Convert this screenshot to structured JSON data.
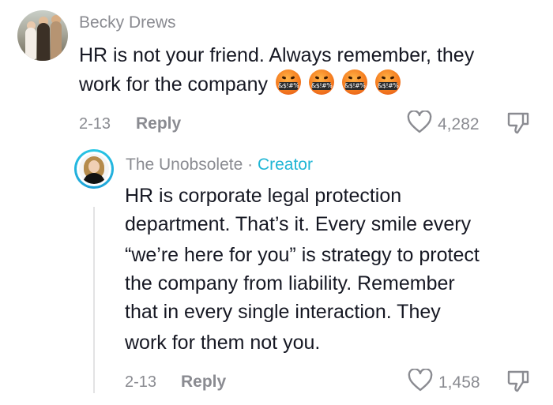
{
  "comment": {
    "username": "Becky Drews",
    "text_line1": "HR is not your friend. Always remember, they",
    "text_line2": "work for the company",
    "emoji_symbols": "&$!#%",
    "emoji_count": 4,
    "date": "2-13",
    "reply_label": "Reply",
    "like_count": "4,282"
  },
  "reply": {
    "username": "The Unobsolete",
    "separator": "·",
    "badge": "Creator",
    "lines": [
      "HR is corporate legal protection",
      "department. That’s it. Every smile every",
      "“we’re here for you” is strategy to protect",
      "the company from liability. Remember",
      "that in every single interaction. They",
      "work for them not you."
    ],
    "date": "2-13",
    "reply_label": "Reply",
    "like_count": "1,458"
  },
  "icons": {
    "like": "heart-outline-icon",
    "dislike": "thumbs-down-outline-icon"
  },
  "colors": {
    "text": "#161823",
    "muted": "#8a8b91",
    "creator_accent": "#20b6d5",
    "thread_line": "#e3e3e4"
  }
}
